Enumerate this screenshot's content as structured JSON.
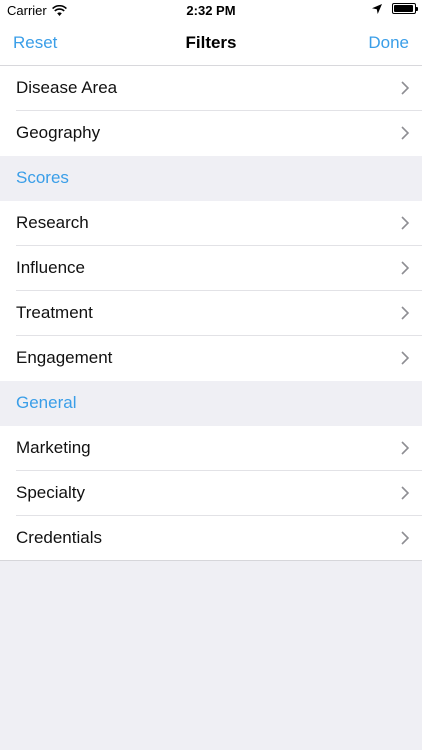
{
  "status_bar": {
    "carrier": "Carrier",
    "time": "2:32 PM",
    "battery_level": 0.95
  },
  "nav": {
    "left_label": "Reset",
    "title": "Filters",
    "right_label": "Done"
  },
  "groups": {
    "top": [
      "Disease Area",
      "Geography"
    ],
    "scores": {
      "header": "Scores",
      "items": [
        "Research",
        "Influence",
        "Treatment",
        "Engagement"
      ]
    },
    "general": {
      "header": "General",
      "items": [
        "Marketing",
        "Specialty",
        "Credentials"
      ]
    }
  },
  "colors": {
    "accent": "#3a9ee8",
    "background": "#efeff4"
  }
}
